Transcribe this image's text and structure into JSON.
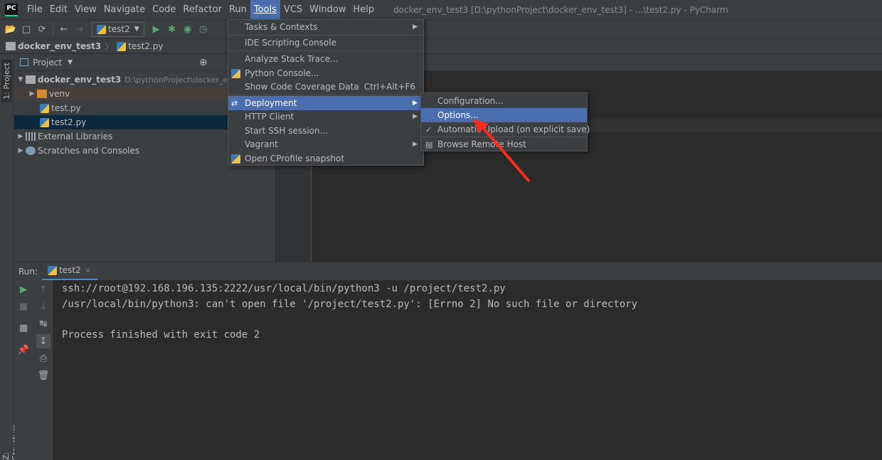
{
  "app": {
    "logo": "PC",
    "window_title": "docker_env_test3 [D:\\pythonProject\\docker_env_test3] - ...\\test2.py - PyCharm"
  },
  "menubar": [
    "File",
    "Edit",
    "View",
    "Navigate",
    "Code",
    "Refactor",
    "Run",
    "Tools",
    "VCS",
    "Window",
    "Help"
  ],
  "toolbar": {
    "run_config": "test2"
  },
  "breadcrumb": {
    "project": "docker_env_test3",
    "file": "test2.py"
  },
  "left_stripe": {
    "project_tab": "1: Project",
    "structure_tab": "Z: Structure"
  },
  "project_panel": {
    "title": "Project",
    "root_name": "docker_env_test3",
    "root_path": "D:\\pythonProject\\docker_env_",
    "items": [
      "venv",
      "test.py",
      "test2.py",
      "External Libraries",
      "Scratches and Consoles"
    ]
  },
  "run_panel": {
    "label": "Run:",
    "tab": "test2"
  },
  "console": {
    "lines": [
      "ssh://root@192.168.196.135:2222/usr/local/bin/python3 -u /project/test2.py",
      "/usr/local/bin/python3: can't open file '/project/test2.py': [Errno 2] No such file or directory",
      "",
      "Process finished with exit code 2"
    ]
  },
  "tools_menu": {
    "items": [
      {
        "label": "Tasks & Contexts"
      },
      {
        "label": "IDE Scripting Console"
      },
      {
        "label": "Analyze Stack Trace..."
      },
      {
        "label": "Python Console..."
      },
      {
        "label": "Show Code Coverage Data",
        "shortcut": "Ctrl+Alt+F6"
      },
      {
        "label": "Deployment"
      },
      {
        "label": "HTTP Client"
      },
      {
        "label": "Start SSH session..."
      },
      {
        "label": "Vagrant"
      },
      {
        "label": "Open CProfile snapshot"
      }
    ]
  },
  "deployment_submenu": {
    "items": [
      {
        "label": "Configuration..."
      },
      {
        "label": "Options..."
      },
      {
        "label": "Automatic Upload (on explicit save)",
        "checked": true
      },
      {
        "label": "Browse Remote Host"
      }
    ]
  },
  "colors": {
    "accent": "#4b6eaf",
    "annotation_arrow": "#ff2a1a"
  }
}
